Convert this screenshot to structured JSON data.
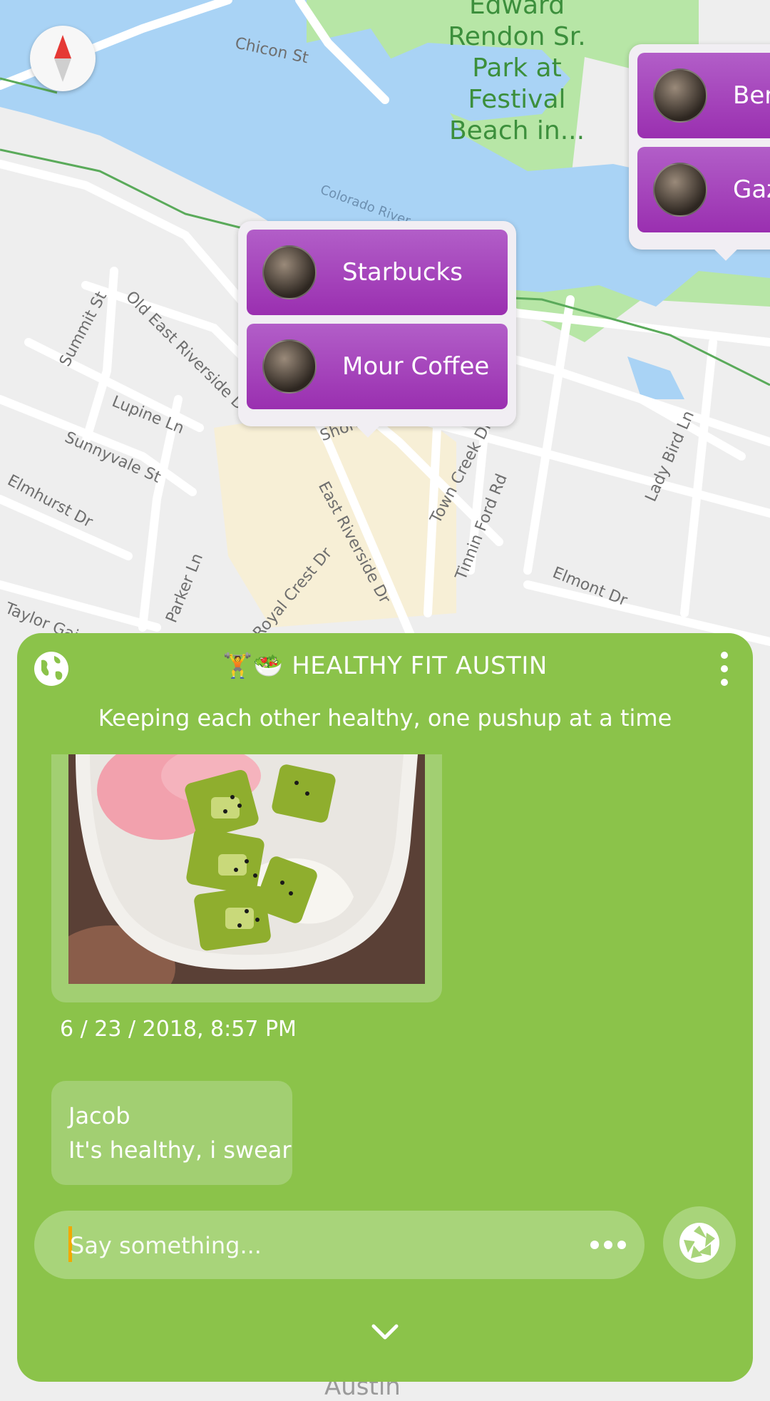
{
  "map": {
    "street_labels": [
      "Chicon St",
      "Colorado River",
      "Old East Riverside Dr",
      "Summit St",
      "Lupine Ln",
      "Sunnyvale St",
      "Elmhurst Dr",
      "Taylor Gaines S",
      "Parker Ln",
      "Royal Crest Dr",
      "East Riverside Dr",
      "Shore",
      "Town Creek Dr",
      "Tinnin Ford Rd",
      "Elmont Dr",
      "Lady Bird Ln"
    ],
    "park_label_lines": [
      "Edward",
      "Rendon Sr.",
      "Park at Festival",
      "Beach in..."
    ],
    "bottom_label": "Austin",
    "colors": {
      "land": "#eeeeee",
      "water": "#a9d3f5",
      "park": "#b7e6a6",
      "road": "#ffffff",
      "sand": "#f7efd6"
    }
  },
  "compass": {
    "icon": "compass-needle-icon"
  },
  "callout_center": {
    "places": [
      {
        "name": "Starbucks"
      },
      {
        "name": "Mour Coffee"
      }
    ]
  },
  "callout_right": {
    "places": [
      {
        "name": "Ben"
      },
      {
        "name": "Gaz"
      }
    ]
  },
  "panel": {
    "title_emoji": "🏋️🥗",
    "title": "HEALTHY FIT AUSTIN",
    "subtitle": "Keeping each other healthy, one pushup at a time",
    "globe_icon": "globe-icon",
    "menu_icon": "vertical-dots-menu-icon",
    "photo_timestamp": "6 / 23 / 2018, 8:57 PM",
    "message": {
      "author": "Jacob",
      "text": "It's healthy, i swear"
    },
    "input": {
      "placeholder": "Say something...",
      "value": ""
    },
    "more_icon": "horizontal-dots-icon",
    "camera_icon": "camera-shutter-icon",
    "collapse_icon": "chevron-down-icon",
    "accent_color": "#8bc34a",
    "place_color": "#a43bbb"
  }
}
